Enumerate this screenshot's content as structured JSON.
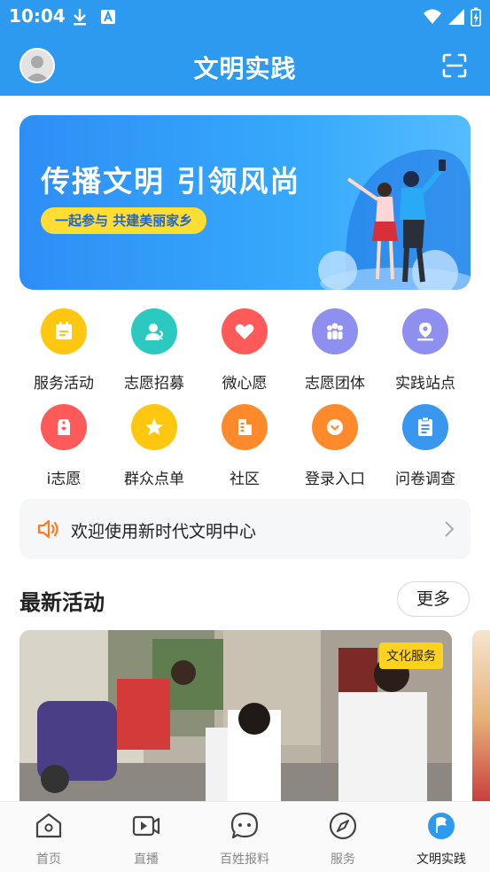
{
  "status_bar": {
    "time": "10:04",
    "icons": [
      "download-icon",
      "a-letter-icon",
      "wifi-icon",
      "signal-icon",
      "battery-charging-icon"
    ]
  },
  "app_bar": {
    "title": "文明实践",
    "left": "avatar",
    "right": "scan-icon"
  },
  "banner": {
    "title": "传播文明 引领风尚",
    "pill": "一起参与 共建美丽家乡"
  },
  "services": [
    {
      "label": "服务活动",
      "icon": "calendar-icon",
      "color": "#ffc70f"
    },
    {
      "label": "志愿招募",
      "icon": "user-recruit-icon",
      "color": "#2bc9c0"
    },
    {
      "label": "微心愿",
      "icon": "heart-icon",
      "color": "#ff5a5a"
    },
    {
      "label": "志愿团体",
      "icon": "group-icon",
      "color": "#8f8ff0"
    },
    {
      "label": "实践站点",
      "icon": "location-icon",
      "color": "#8f8ff0"
    },
    {
      "label": "i志愿",
      "icon": "volunteer-tag-icon",
      "color": "#ff5a5a"
    },
    {
      "label": "群众点单",
      "icon": "star-icon",
      "color": "#ffc70f"
    },
    {
      "label": "社区",
      "icon": "building-icon",
      "color": "#ff8a2c"
    },
    {
      "label": "登录入口",
      "icon": "login-icon",
      "color": "#ff8a2c"
    },
    {
      "label": "问卷调查",
      "icon": "clipboard-icon",
      "color": "#3a97f0"
    }
  ],
  "notice": {
    "text": "欢迎使用新时代文明中心",
    "icon": "speaker-icon"
  },
  "latest": {
    "title": "最新活动",
    "more_label": "更多",
    "cards": [
      {
        "tag": "文化服务"
      }
    ]
  },
  "tabbar": {
    "tabs": [
      {
        "label": "首页",
        "icon": "home-icon",
        "active": false
      },
      {
        "label": "直播",
        "icon": "live-video-icon",
        "active": false
      },
      {
        "label": "百姓报料",
        "icon": "chat-icon",
        "active": false
      },
      {
        "label": "服务",
        "icon": "compass-icon",
        "active": false
      },
      {
        "label": "文明实践",
        "icon": "flag-icon",
        "active": true
      }
    ]
  },
  "colors": {
    "primary": "#2d9af0",
    "accent_yellow": "#ffdd33",
    "text": "#222222"
  }
}
